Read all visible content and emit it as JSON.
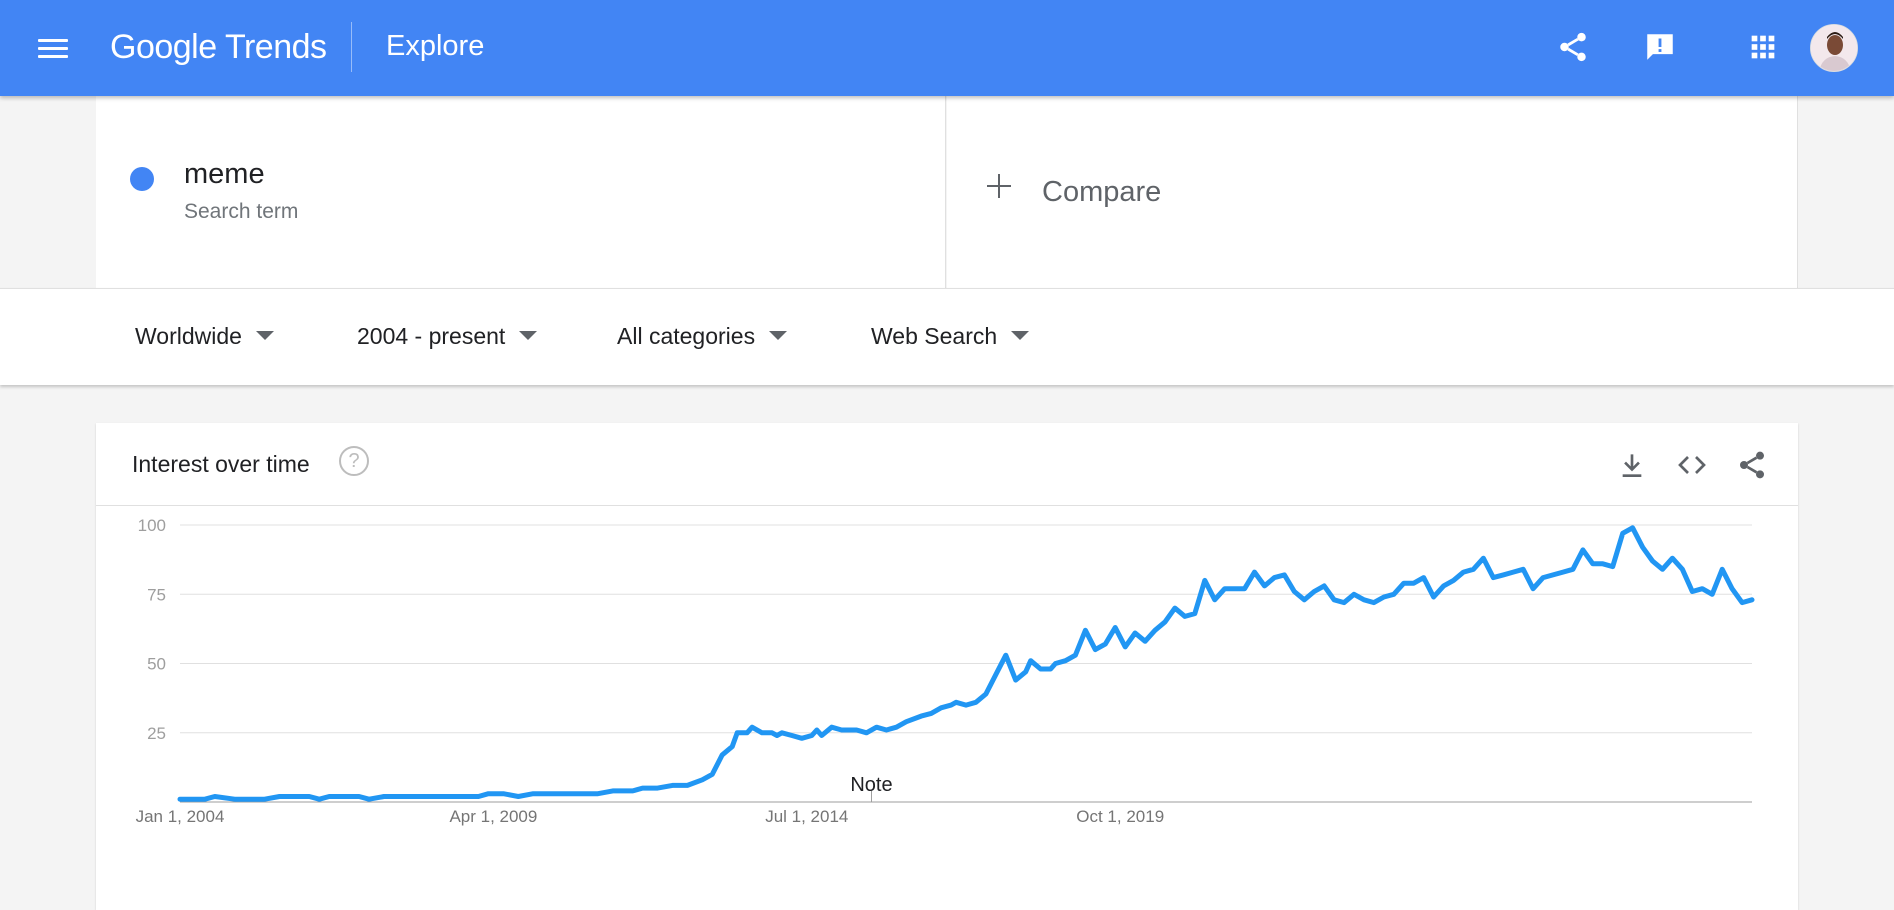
{
  "header": {
    "menu_icon": "menu-icon",
    "logo_text": "Google Trends",
    "title": "Explore",
    "icons": [
      "share-icon",
      "feedback-icon",
      "apps-grid-icon"
    ],
    "avatar": "user-avatar",
    "background_color": "#4285f4"
  },
  "search_term": {
    "name": "meme",
    "subtitle": "Search term",
    "color": "#4285f4"
  },
  "compare": {
    "label": "Compare"
  },
  "filters": {
    "region": "Worldwide",
    "time": "2004 - present",
    "category": "All categories",
    "property": "Web Search"
  },
  "card": {
    "title": "Interest over time",
    "icons": [
      "help-icon",
      "download-icon",
      "embed-code-icon",
      "share-icon"
    ]
  },
  "chart_data": {
    "type": "line",
    "title": "",
    "xlabel": "",
    "ylabel": "",
    "ylim": [
      0,
      100
    ],
    "yticks": [
      25,
      50,
      75,
      100
    ],
    "grid": true,
    "x_tick_labels": [
      "Jan 1, 2004",
      "Apr 1, 2009",
      "Jul 1, 2014",
      "Oct 1, 2019"
    ],
    "annotation": {
      "label": "Note",
      "x": "2015-08"
    },
    "series": [
      {
        "name": "meme",
        "color": "#2196f3",
        "points": [
          [
            "2004-01",
            1
          ],
          [
            "2004-06",
            1
          ],
          [
            "2004-08",
            2
          ],
          [
            "2004-12",
            1
          ],
          [
            "2005-06",
            1
          ],
          [
            "2005-09",
            2
          ],
          [
            "2006-03",
            2
          ],
          [
            "2006-05",
            1
          ],
          [
            "2006-07",
            2
          ],
          [
            "2007-01",
            2
          ],
          [
            "2007-03",
            1
          ],
          [
            "2007-06",
            2
          ],
          [
            "2008-01",
            2
          ],
          [
            "2008-06",
            2
          ],
          [
            "2009-01",
            2
          ],
          [
            "2009-03",
            3
          ],
          [
            "2009-06",
            3
          ],
          [
            "2009-09",
            2
          ],
          [
            "2009-12",
            3
          ],
          [
            "2010-06",
            3
          ],
          [
            "2010-09",
            3
          ],
          [
            "2011-01",
            3
          ],
          [
            "2011-04",
            4
          ],
          [
            "2011-08",
            4
          ],
          [
            "2011-10",
            5
          ],
          [
            "2012-01",
            5
          ],
          [
            "2012-04",
            6
          ],
          [
            "2012-07",
            6
          ],
          [
            "2012-10",
            8
          ],
          [
            "2012-12",
            10
          ],
          [
            "2013-02",
            17
          ],
          [
            "2013-04",
            20
          ],
          [
            "2013-05",
            25
          ],
          [
            "2013-07",
            25
          ],
          [
            "2013-08",
            27
          ],
          [
            "2013-10",
            25
          ],
          [
            "2013-12",
            25
          ],
          [
            "2014-01",
            24
          ],
          [
            "2014-02",
            25
          ],
          [
            "2014-04",
            24
          ],
          [
            "2014-06",
            23
          ],
          [
            "2014-08",
            24
          ],
          [
            "2014-09",
            26
          ],
          [
            "2014-10",
            24
          ],
          [
            "2014-12",
            27
          ],
          [
            "2015-02",
            26
          ],
          [
            "2015-05",
            26
          ],
          [
            "2015-07",
            25
          ],
          [
            "2015-09",
            27
          ],
          [
            "2015-11",
            26
          ],
          [
            "2016-01",
            27
          ],
          [
            "2016-03",
            29
          ],
          [
            "2016-06",
            31
          ],
          [
            "2016-08",
            32
          ],
          [
            "2016-10",
            34
          ],
          [
            "2016-12",
            35
          ],
          [
            "2017-01",
            36
          ],
          [
            "2017-03",
            35
          ],
          [
            "2017-05",
            36
          ],
          [
            "2017-07",
            39
          ],
          [
            "2017-09",
            46
          ],
          [
            "2017-11",
            53
          ],
          [
            "2018-01",
            44
          ],
          [
            "2018-03",
            47
          ],
          [
            "2018-04",
            51
          ],
          [
            "2018-06",
            48
          ],
          [
            "2018-08",
            48
          ],
          [
            "2018-09",
            50
          ],
          [
            "2018-11",
            51
          ],
          [
            "2019-01",
            53
          ],
          [
            "2019-03",
            62
          ],
          [
            "2019-05",
            55
          ],
          [
            "2019-07",
            57
          ],
          [
            "2019-09",
            63
          ],
          [
            "2019-11",
            56
          ],
          [
            "2020-01",
            61
          ],
          [
            "2020-03",
            58
          ],
          [
            "2020-05",
            62
          ],
          [
            "2020-07",
            65
          ],
          [
            "2020-09",
            70
          ],
          [
            "2020-11",
            67
          ],
          [
            "2021-01",
            68
          ],
          [
            "2021-03",
            80
          ],
          [
            "2021-05",
            73
          ],
          [
            "2021-07",
            77
          ],
          [
            "2021-09",
            77
          ],
          [
            "2021-11",
            77
          ],
          [
            "2022-01",
            83
          ],
          [
            "2022-03",
            78
          ],
          [
            "2022-05",
            81
          ],
          [
            "2022-07",
            82
          ],
          [
            "2022-09",
            76
          ],
          [
            "2022-11",
            73
          ],
          [
            "2023-01",
            76
          ],
          [
            "2023-03",
            78
          ],
          [
            "2023-05",
            73
          ],
          [
            "2023-07",
            72
          ],
          [
            "2023-09",
            75
          ],
          [
            "2023-11",
            73
          ],
          [
            "2024-01",
            72
          ],
          [
            "2024-03",
            74
          ],
          [
            "2024-05",
            75
          ],
          [
            "2024-07",
            79
          ],
          [
            "2024-09",
            79
          ],
          [
            "2024-11",
            81
          ],
          [
            "2025-01",
            74
          ],
          [
            "2025-03",
            78
          ],
          [
            "2025-05",
            80
          ],
          [
            "2025-07",
            83
          ],
          [
            "2025-09",
            84
          ],
          [
            "2025-11",
            88
          ],
          [
            "2026-01",
            81
          ],
          [
            "2026-03",
            82
          ],
          [
            "2026-05",
            83
          ],
          [
            "2026-07",
            84
          ],
          [
            "2026-09",
            77
          ],
          [
            "2026-11",
            81
          ],
          [
            "2027-01",
            82
          ],
          [
            "2027-03",
            83
          ],
          [
            "2027-05",
            84
          ],
          [
            "2027-07",
            91
          ],
          [
            "2027-09",
            86
          ],
          [
            "2027-11",
            86
          ],
          [
            "2028-01",
            85
          ],
          [
            "2028-03",
            97
          ],
          [
            "2028-05",
            99
          ],
          [
            "2028-07",
            92
          ],
          [
            "2028-09",
            87
          ],
          [
            "2028-11",
            84
          ],
          [
            "2029-01",
            88
          ],
          [
            "2029-03",
            84
          ],
          [
            "2029-05",
            76
          ],
          [
            "2029-07",
            77
          ],
          [
            "2029-09",
            75
          ],
          [
            "2029-11",
            84
          ],
          [
            "2030-01",
            77
          ],
          [
            "2030-03",
            72
          ],
          [
            "2030-05",
            73
          ]
        ]
      }
    ]
  }
}
